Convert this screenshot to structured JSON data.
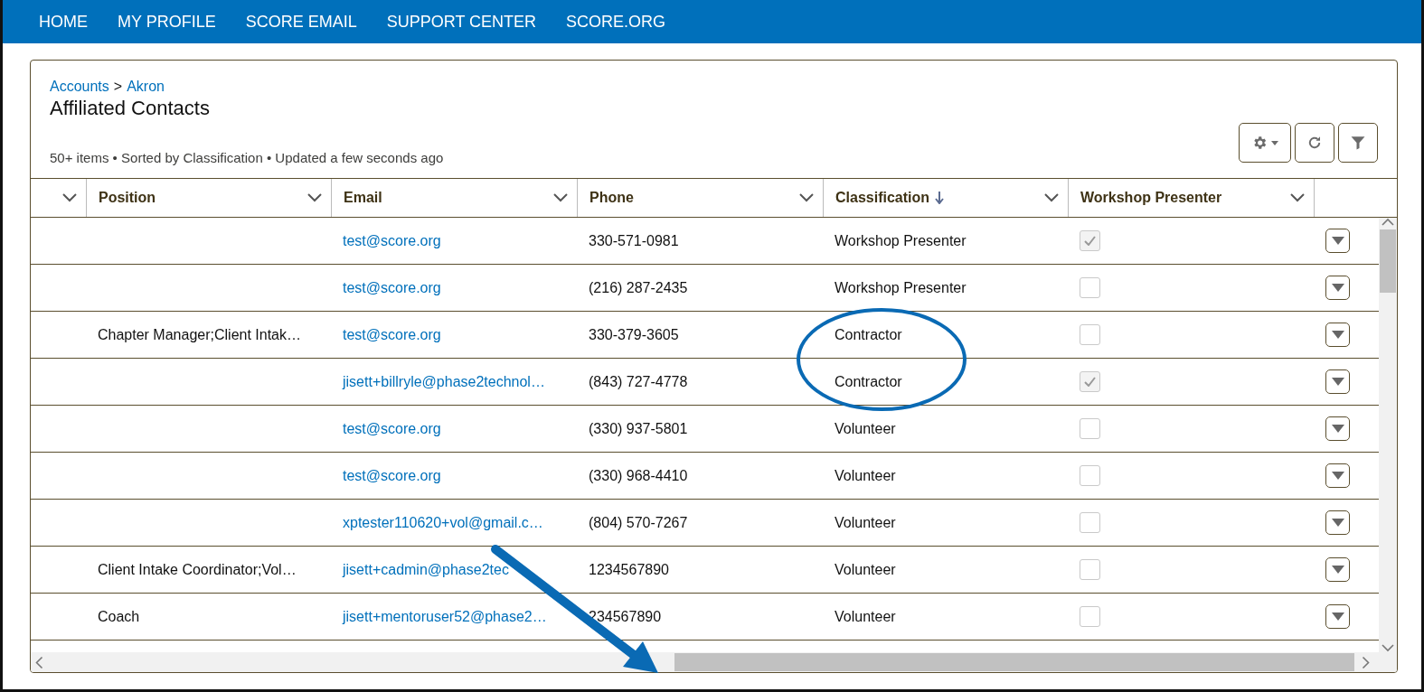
{
  "nav": [
    {
      "label": "HOME"
    },
    {
      "label": "MY PROFILE"
    },
    {
      "label": "SCORE EMAIL"
    },
    {
      "label": "SUPPORT CENTER"
    },
    {
      "label": "SCORE.ORG"
    }
  ],
  "breadcrumb": {
    "items": [
      "Accounts",
      "Akron"
    ],
    "separator": ">"
  },
  "title": "Affiliated Contacts",
  "status": "50+ items • Sorted by Classification • Updated a few seconds ago",
  "columns": [
    {
      "label": "Position",
      "sorted": false
    },
    {
      "label": "Email",
      "sorted": false
    },
    {
      "label": "Phone",
      "sorted": false
    },
    {
      "label": "Classification",
      "sorted": true
    },
    {
      "label": "Workshop Presenter",
      "sorted": false
    }
  ],
  "rows": [
    {
      "position": "",
      "email": "test@score.org",
      "phone": "330-571-0981",
      "classification": "Workshop Presenter",
      "checked": true
    },
    {
      "position": "",
      "email": "test@score.org",
      "phone": "(216) 287-2435",
      "classification": "Workshop Presenter",
      "checked": false
    },
    {
      "position": "Chapter Manager;Client Intak…",
      "email": "test@score.org",
      "phone": "330-379-3605",
      "classification": "Contractor",
      "checked": false
    },
    {
      "position": "",
      "email": "jisett+billryle@phase2technol…",
      "phone": "(843) 727-4778",
      "classification": "Contractor",
      "checked": true
    },
    {
      "position": "",
      "email": "test@score.org",
      "phone": "(330) 937-5801",
      "classification": "Volunteer",
      "checked": false
    },
    {
      "position": "",
      "email": "test@score.org",
      "phone": "(330) 968-4410",
      "classification": "Volunteer",
      "checked": false
    },
    {
      "position": "",
      "email": "xptester110620+vol@gmail.c…",
      "phone": "(804) 570-7267",
      "classification": "Volunteer",
      "checked": false
    },
    {
      "position": "Client Intake Coordinator;Vol…",
      "email": "jisett+cadmin@phase2tec",
      "phone": "1234567890",
      "classification": "Volunteer",
      "checked": false
    },
    {
      "position": "Coach",
      "email": "jisett+mentoruser52@phase2…",
      "phone": "234567890",
      "classification": "Volunteer",
      "checked": false
    }
  ]
}
